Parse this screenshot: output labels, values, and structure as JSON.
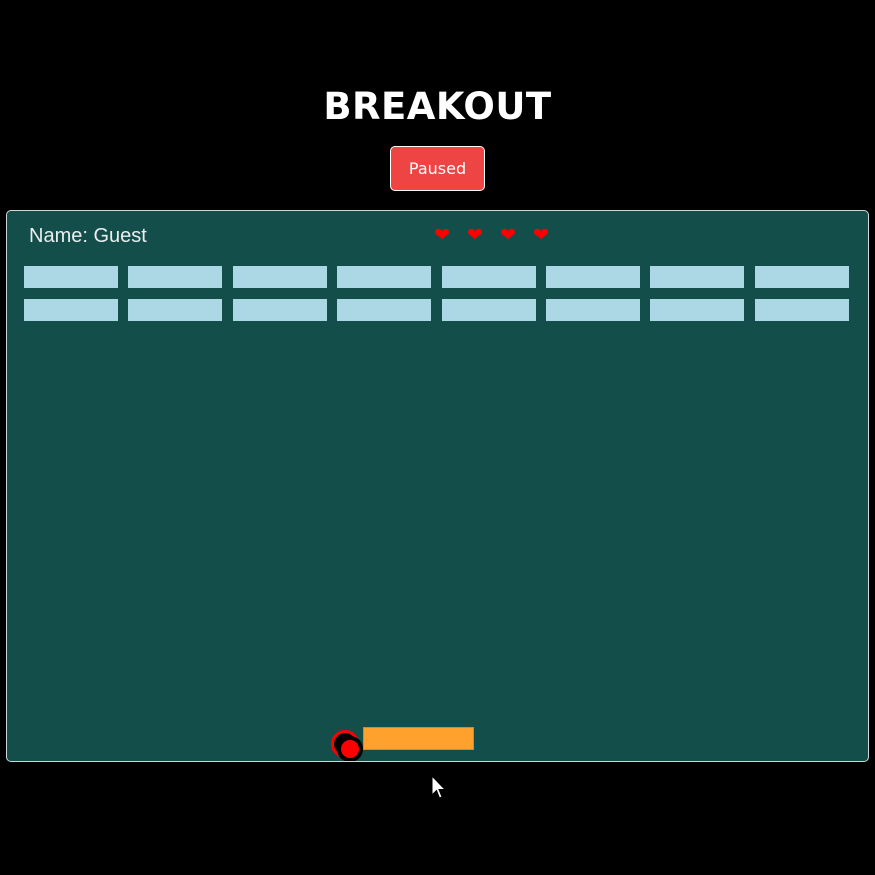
{
  "game": {
    "title": "BREAKOUT",
    "pause_button_label": "Paused",
    "player_name": "Name: Guest",
    "lives": 4,
    "heart_glyph": "❤",
    "bricks": {
      "rows": 2,
      "columns": 8
    }
  },
  "colors": {
    "page_background": "#000000",
    "board_background": "#144e4b",
    "pause_button": "#ef4444",
    "brick": "#acd8e5",
    "paddle": "#ffa12c",
    "ball": "#ff0000",
    "heart": "#ff0000"
  }
}
